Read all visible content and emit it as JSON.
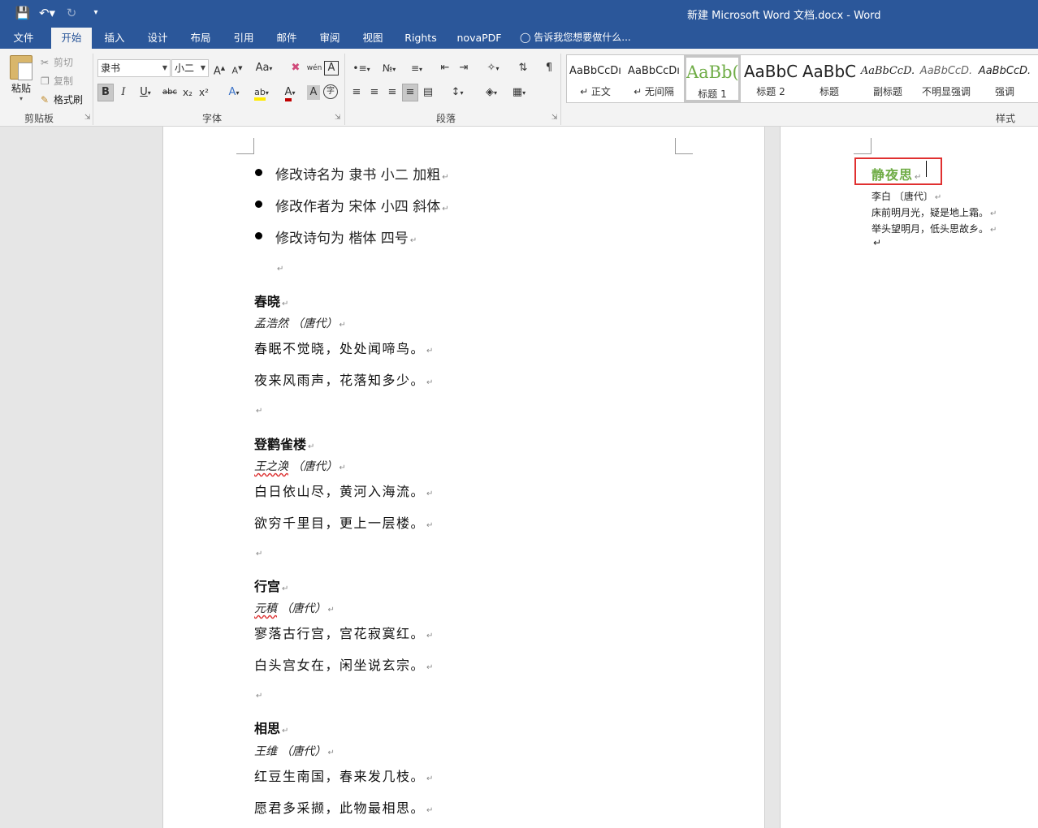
{
  "titlebar": {
    "title": "新建 Microsoft Word 文档.docx - Word",
    "qat": [
      "save-icon",
      "undo-icon",
      "redo-icon",
      "customize-icon"
    ]
  },
  "tabs": {
    "items": [
      "文件",
      "开始",
      "插入",
      "设计",
      "布局",
      "引用",
      "邮件",
      "审阅",
      "视图",
      "Rights",
      "novaPDF"
    ],
    "active": "开始",
    "tell_me": "告诉我您想要做什么..."
  },
  "clipboard": {
    "paste": "粘贴",
    "cut": "剪切",
    "copy": "复制",
    "format_painter": "格式刷",
    "label": "剪贴板"
  },
  "font": {
    "name": "隶书",
    "size": "小二",
    "label": "字体",
    "grow": "A",
    "shrink": "A",
    "case": "Aa",
    "phonetic": "wén",
    "charborder": "A",
    "bold": "B",
    "italic": "I",
    "underline": "U",
    "strike": "abc",
    "sub": "x₂",
    "sup": "x²",
    "effects": "A",
    "highlight": "ab",
    "color": "A",
    "shading": "A",
    "enclose": "字"
  },
  "paragraph": {
    "label": "段落"
  },
  "styles": {
    "label": "样式",
    "items": [
      {
        "preview": "AaBbCcDı",
        "name": "↵ 正文"
      },
      {
        "preview": "AaBbCcDı",
        "name": "↵ 无间隔"
      },
      {
        "preview": "AaBb(",
        "name": "标题 1"
      },
      {
        "preview": "AaBbC",
        "name": "标题 2"
      },
      {
        "preview": "AaBbC",
        "name": "标题"
      },
      {
        "preview": "AaBbCcD.",
        "name": "副标题"
      },
      {
        "preview": "AaBbCcD.",
        "name": "不明显强调"
      },
      {
        "preview": "AaBbCcD.",
        "name": "强调"
      }
    ],
    "selected_index": 2,
    "accent": "#70ad47"
  },
  "page1": {
    "bullets": [
      "修改诗名为 隶书 小二 加粗",
      "修改作者为 宋体 小四 斜体",
      "修改诗句为 楷体 四号"
    ],
    "poems": [
      {
        "title": "春晓",
        "author": "孟浩然",
        "dynasty": "（唐代）",
        "verses": [
          "春眠不觉晓，处处闻啼鸟。",
          "夜来风雨声，花落知多少。"
        ]
      },
      {
        "title": "登鹳雀楼",
        "author": "王之涣",
        "dynasty": "（唐代）",
        "verses": [
          "白日依山尽，黄河入海流。",
          "欲穷千里目，更上一层楼。"
        ]
      },
      {
        "title": "行宫",
        "author": "元稹",
        "dynasty": "（唐代）",
        "verses": [
          "寥落古行宫，宫花寂寞红。",
          "白头宫女在，闲坐说玄宗。"
        ]
      },
      {
        "title": "相思",
        "author": "王维",
        "dynasty": "（唐代）",
        "verses": [
          "红豆生南国，春来发几枝。",
          "愿君多采撷，此物最相思。"
        ]
      }
    ],
    "para_mark": "↵"
  },
  "page2": {
    "title": "静夜思",
    "author_line": "李白 〔唐代〕",
    "verse1": "床前明月光，疑是地上霜。",
    "verse2": "举头望明月，低头思故乡。",
    "highlight_color": "#e03030"
  },
  "colors": {
    "brand": "#2b579a",
    "ribbon_bg": "#f3f3f3",
    "doc_bg": "#e6e6e6"
  }
}
